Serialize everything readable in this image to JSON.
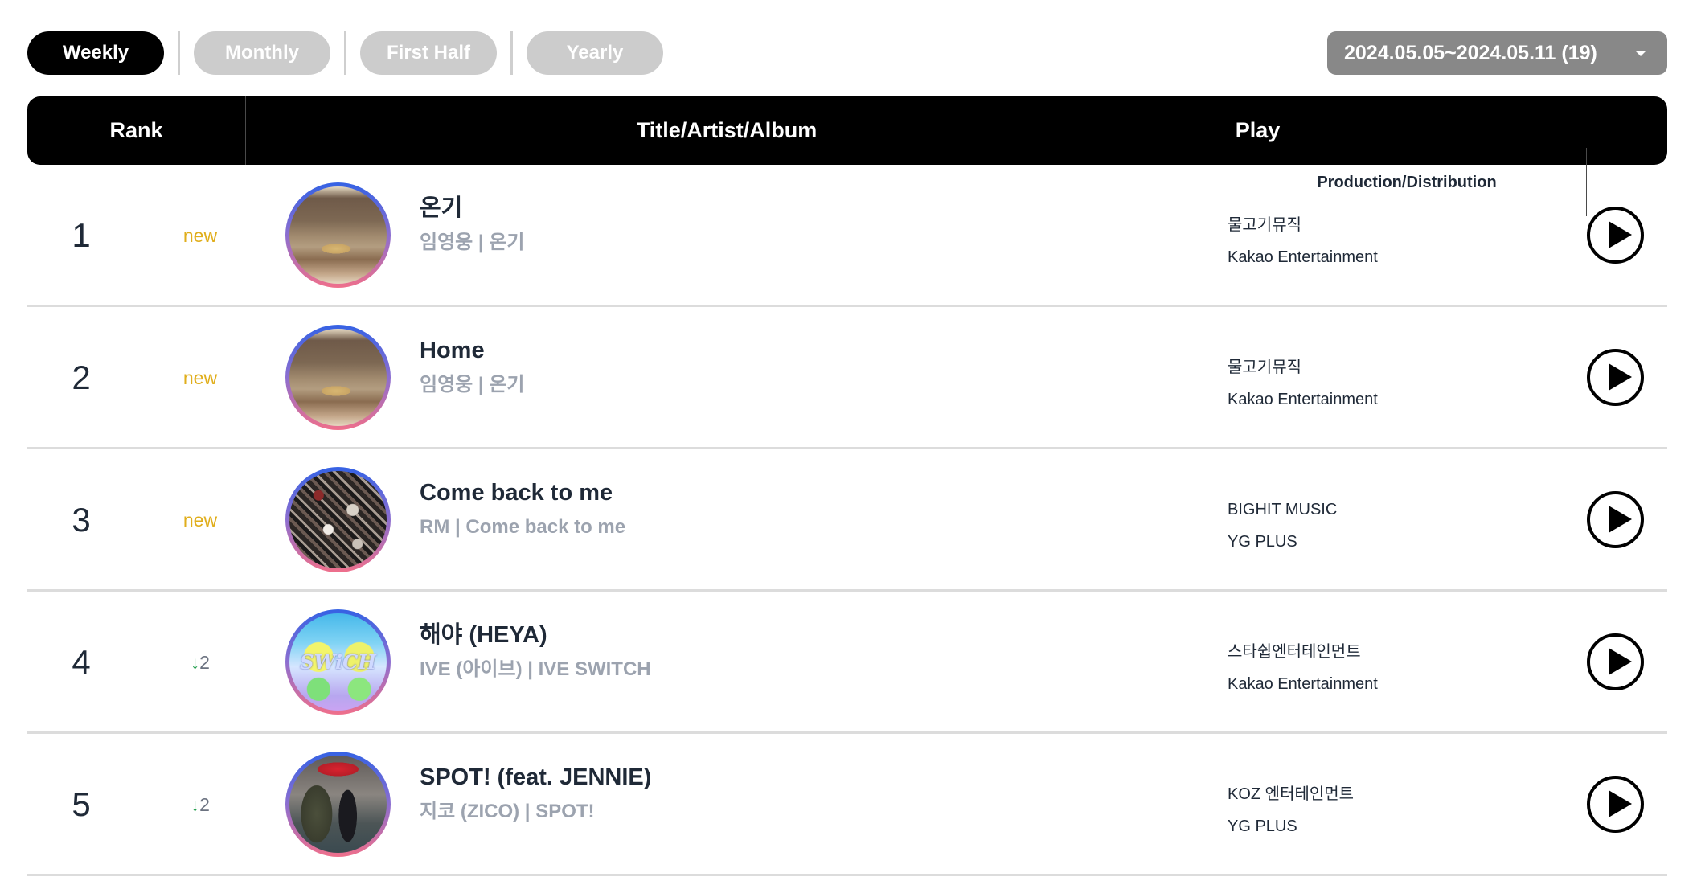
{
  "tabs": [
    {
      "label": "Weekly",
      "active": true
    },
    {
      "label": "Monthly",
      "active": false
    },
    {
      "label": "First Half",
      "active": false
    },
    {
      "label": "Yearly",
      "active": false
    }
  ],
  "period_select": {
    "value": "2024.05.05~2024.05.11 (19)"
  },
  "table": {
    "headers": {
      "rank": "Rank",
      "title": "Title/Artist/Album",
      "production": "Production/Distribution",
      "play": "Play"
    },
    "rows": [
      {
        "rank": "1",
        "change": {
          "type": "new",
          "label": "new"
        },
        "art": "album-art-onggi",
        "title": "온기",
        "artist_album": "임영웅 | 온기",
        "production": "물고기뮤직",
        "distribution": "Kakao Entertainment"
      },
      {
        "rank": "2",
        "change": {
          "type": "new",
          "label": "new"
        },
        "art": "album-art-onggi",
        "title": "Home",
        "artist_album": "임영웅 | 온기",
        "production": "물고기뮤직",
        "distribution": "Kakao Entertainment"
      },
      {
        "rank": "3",
        "change": {
          "type": "new",
          "label": "new"
        },
        "art": "album-art-come-back-to-me",
        "title": "Come back to me",
        "artist_album": "RM | Come back to me",
        "production": "BIGHIT MUSIC",
        "distribution": "YG PLUS"
      },
      {
        "rank": "4",
        "change": {
          "type": "down",
          "arrow": "↓",
          "amount": "2"
        },
        "art": "album-art-ive-switch",
        "title": "해야 (HEYA)",
        "artist_album": "IVE (아이브) | IVE SWITCH",
        "production": "스타쉽엔터테인먼트",
        "distribution": "Kakao Entertainment"
      },
      {
        "rank": "5",
        "change": {
          "type": "down",
          "arrow": "↓",
          "amount": "2"
        },
        "art": "album-art-spot",
        "title": "SPOT! (feat. JENNIE)",
        "artist_album": "지코 (ZICO) | SPOT!",
        "production": "KOZ 엔터테인먼트",
        "distribution": "YG PLUS"
      }
    ]
  },
  "colors": {
    "active_tab": "#000000",
    "inactive_tab": "#cccccc",
    "dropdown_bg": "#888888",
    "new_badge": "#e0ae1c",
    "down_arrow": "#1f9d4a",
    "subtitle": "#9ca3af",
    "art_ring_top": "#3562e4",
    "art_ring_bottom": "#ef6f8b"
  }
}
